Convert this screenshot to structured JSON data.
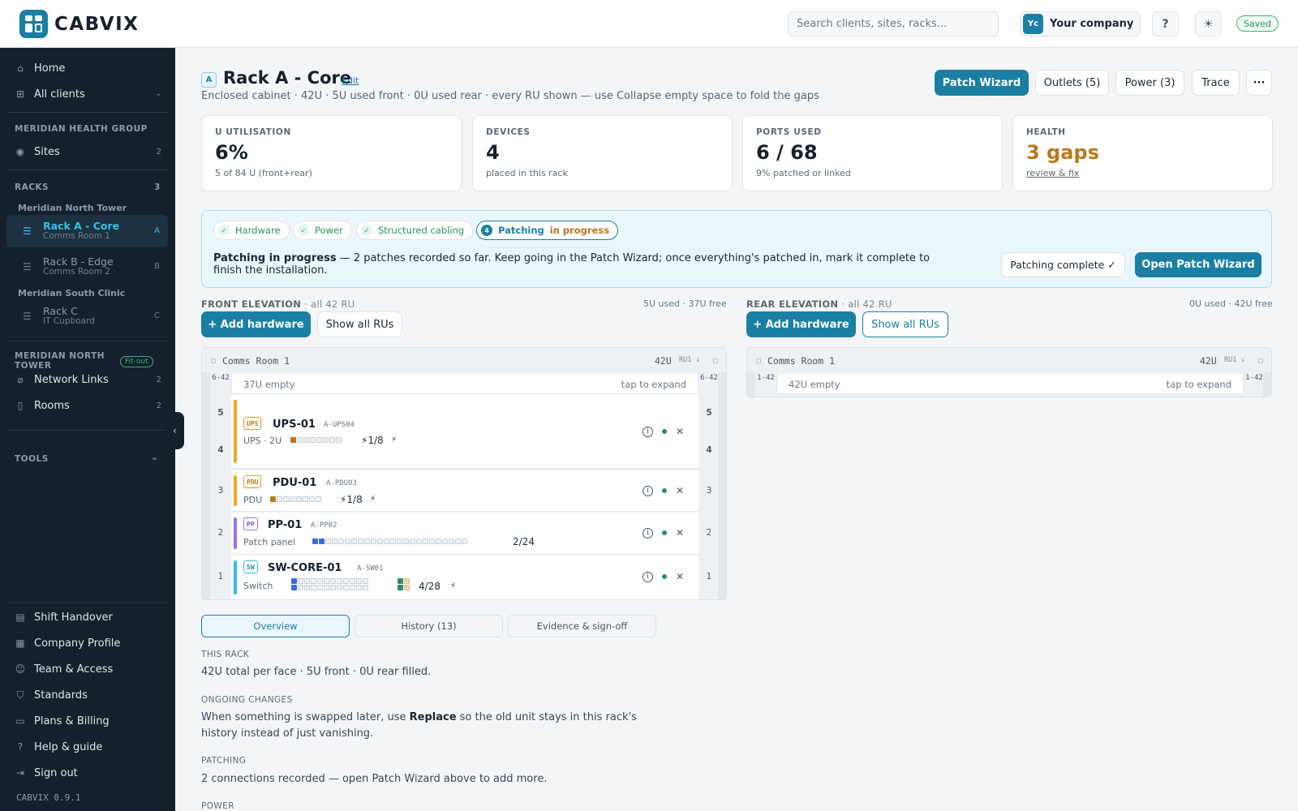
{
  "header": {
    "logo_text": "CABVIX",
    "search_placeholder": "Search clients, sites, racks...",
    "company_initials": "Yc",
    "company_name": "Your company",
    "help_label": "?",
    "theme_glyph": "☀",
    "saved_label": "Saved"
  },
  "sidebar": {
    "home": "Home",
    "all_clients": "All clients",
    "group_name": "MERIDIAN HEALTH GROUP",
    "sites": {
      "label": "Sites",
      "count": "2"
    },
    "racks_heading": "RACKS",
    "racks_count": "3",
    "site_north": "Meridian North Tower",
    "site_south": "Meridian South Clinic",
    "racks": [
      {
        "name": "Rack A - Core",
        "room": "Comms Room 1",
        "letter": "A"
      },
      {
        "name": "Rack B - Edge",
        "room": "Comms Room 2",
        "letter": "B"
      },
      {
        "name": "Rack C",
        "room": "IT Cupboard",
        "letter": "C"
      }
    ],
    "site_section": "MERIDIAN NORTH TOWER",
    "fitout_badge": "Fit-out",
    "network_links": {
      "label": "Network Links",
      "count": "2"
    },
    "rooms": {
      "label": "Rooms",
      "count": "2"
    },
    "tools": "TOOLS",
    "bottom": [
      "Shift Handover",
      "Company Profile",
      "Team & Access",
      "Standards",
      "Plans & Billing",
      "Help & guide",
      "Sign out"
    ],
    "version": "CABVIX 0.9.1"
  },
  "rack": {
    "letter": "A",
    "title": "Rack A - Core",
    "edit": "Edit",
    "subtitle": "Enclosed cabinet · 42U · 5U used front · 0U used rear · every RU shown — use Collapse empty space to fold the gaps"
  },
  "actions": {
    "patch_wizard": "Patch Wizard",
    "outlets": "Outlets (5)",
    "power": "Power (3)",
    "trace": "Trace",
    "more": "···"
  },
  "stats": [
    {
      "label": "U UTILISATION",
      "value": "6%",
      "note": "5 of 84 U (front+rear)"
    },
    {
      "label": "DEVICES",
      "value": "4",
      "note": "placed in this rack"
    },
    {
      "label": "PORTS USED",
      "value": "6 / 68",
      "note": "9% patched or linked"
    },
    {
      "label": "HEALTH",
      "value": "3 gaps",
      "note": "review & fix"
    }
  ],
  "progress": {
    "steps": [
      "Hardware",
      "Power",
      "Structured cabling"
    ],
    "current_num": "4",
    "current_label": "Patching",
    "current_state": "in progress",
    "msg_bold": "Patching in progress",
    "msg_rest": " — 2 patches recorded so far. Keep going in the Patch Wizard; once everything's patched in, mark it complete to finish the installation.",
    "complete_btn": "Patching complete ✓",
    "open_btn": "Open Patch Wizard"
  },
  "front": {
    "heading": "FRONT ELEVATION",
    "heading_sub": " · all 42 RU",
    "stat": "5U used · 37U free",
    "add": "+ Add hardware",
    "show": "Show all RUs",
    "room": "Comms Room 1",
    "units": "42U",
    "order": "RU1 ↓",
    "empty_range": "6-42",
    "empty_label": "37U empty",
    "expand": "tap to expand",
    "devices": [
      {
        "tag": "UPS",
        "name": "UPS-01",
        "asset": "A-UPS04",
        "type": "UPS · 2U",
        "count": "⚡1/8",
        "top_u": "5",
        "bot_u": "4",
        "color": "#f0a81f"
      },
      {
        "tag": "PDU",
        "name": "PDU-01",
        "asset": "A-PDU03",
        "type": "PDU",
        "count": "⚡1/8",
        "u": "3",
        "color": "#f0a81f"
      },
      {
        "tag": "PP",
        "name": "PP-01",
        "asset": "A-PP02",
        "type": "Patch panel",
        "count": "2/24",
        "u": "2",
        "color": "#9b72e0"
      },
      {
        "tag": "SW",
        "name": "SW-CORE-01",
        "asset": "A-SW01",
        "type": "Switch",
        "count": "4/28",
        "u": "1",
        "color": "#2fc0e0"
      }
    ]
  },
  "rear": {
    "heading": "REAR ELEVATION",
    "heading_sub": " · all 42 RU",
    "stat": "0U used · 42U free",
    "add": "+ Add hardware",
    "show": "Show all RUs",
    "room": "Comms Room 1",
    "units": "42U",
    "order": "RU1 ↓",
    "empty_range": "1-42",
    "empty_label": "42U empty",
    "expand": "tap to expand"
  },
  "tabs": [
    "Overview",
    "History (13)",
    "Evidence & sign-off"
  ],
  "overview": {
    "this_rack_h": "THIS RACK",
    "this_rack_t": "42U total per face · 5U front · 0U rear filled.",
    "changes_h": "ONGOING CHANGES",
    "changes_pre": "When something is swapped later, use ",
    "changes_bold": "Replace",
    "changes_post": " so the old unit stays in this rack's history instead of just vanishing.",
    "patching_h": "PATCHING",
    "patching_t": "2 connections recorded — open Patch Wizard above to add more.",
    "power_h": "POWER"
  }
}
